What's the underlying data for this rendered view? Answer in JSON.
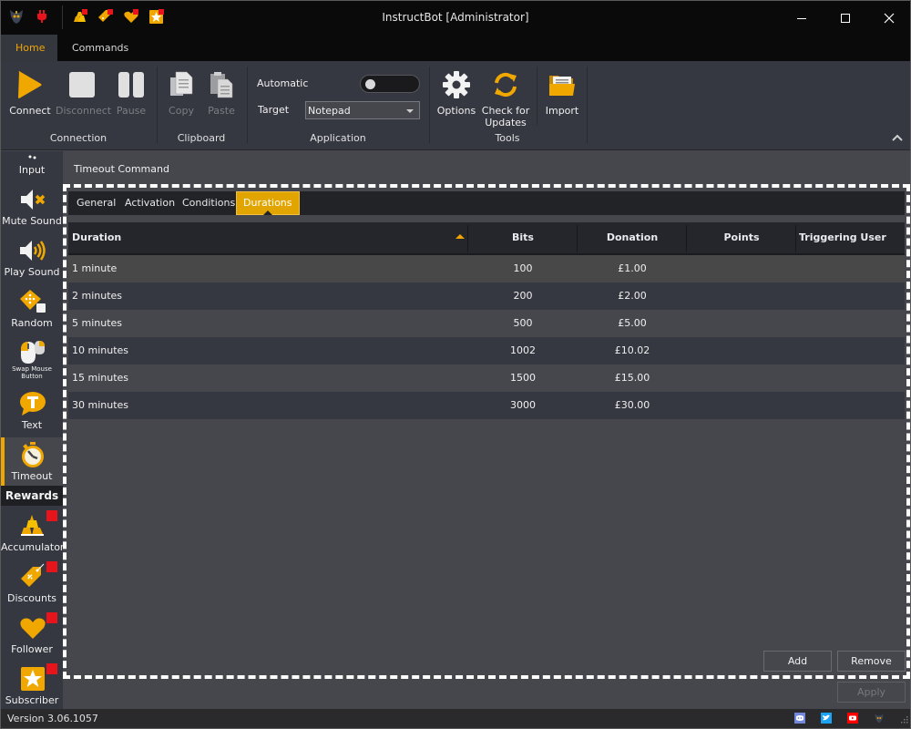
{
  "window": {
    "title": "InstructBot [Administrator]",
    "controls": [
      "minimize",
      "maximize",
      "close"
    ]
  },
  "quick_access": [
    {
      "icon": "instructbot-logo-icon"
    },
    {
      "icon": "plug-icon"
    },
    {
      "icon": "accumulator-icon"
    },
    {
      "icon": "discount-tag-icon"
    },
    {
      "icon": "heart-icon"
    },
    {
      "icon": "star-icon"
    }
  ],
  "menu_tabs": [
    {
      "label": "Home",
      "active": true
    },
    {
      "label": "Commands",
      "active": false
    }
  ],
  "ribbon": {
    "connection": {
      "group_label": "Connection",
      "connect": "Connect",
      "disconnect": "Disconnect",
      "pause": "Pause"
    },
    "clipboard": {
      "group_label": "Clipboard",
      "copy": "Copy",
      "paste": "Paste"
    },
    "application": {
      "group_label": "Application",
      "automatic_label": "Automatic",
      "automatic_on": false,
      "target_label": "Target",
      "target_value": "Notepad"
    },
    "tools": {
      "group_label": "Tools",
      "options": "Options",
      "check_updates": "Check for Updates"
    },
    "import": "Import"
  },
  "sidebar": {
    "items": [
      {
        "label": "Input",
        "icon": "input-icon"
      },
      {
        "label": "Mute Sound",
        "icon": "mute-sound-icon"
      },
      {
        "label": "Play Sound",
        "icon": "play-sound-icon"
      },
      {
        "label": "Random",
        "icon": "dice-icon"
      },
      {
        "label": "Swap Mouse Button",
        "icon": "mouse-icon"
      },
      {
        "label": "Text",
        "icon": "text-bubble-icon"
      },
      {
        "label": "Timeout",
        "icon": "stopwatch-icon",
        "active": true
      }
    ],
    "rewards_header": "Rewards",
    "rewards": [
      {
        "label": "Accumulator",
        "icon": "accumulator-icon",
        "badge": true
      },
      {
        "label": "Discounts",
        "icon": "discount-tag-icon",
        "badge": true
      },
      {
        "label": "Follower",
        "icon": "heart-icon",
        "badge": true
      },
      {
        "label": "Subscriber",
        "icon": "star-icon",
        "badge": true
      }
    ]
  },
  "main": {
    "title": "Timeout Command",
    "tabs": [
      {
        "label": "General"
      },
      {
        "label": "Activation"
      },
      {
        "label": "Conditions"
      },
      {
        "label": "Durations",
        "active": true
      }
    ],
    "grid": {
      "columns": [
        "Duration",
        "Bits",
        "Donation",
        "Points",
        "Triggering User Only"
      ],
      "sort_column": "Duration",
      "sort_direction": "ascending",
      "rows": [
        {
          "duration": "1 minute",
          "bits": "100",
          "donation": "£1.00",
          "points": "",
          "triggering_user_only": "",
          "selected": true
        },
        {
          "duration": "2 minutes",
          "bits": "200",
          "donation": "£2.00",
          "points": "",
          "triggering_user_only": ""
        },
        {
          "duration": "5 minutes",
          "bits": "500",
          "donation": "£5.00",
          "points": "",
          "triggering_user_only": ""
        },
        {
          "duration": "10 minutes",
          "bits": "1002",
          "donation": "£10.02",
          "points": "",
          "triggering_user_only": ""
        },
        {
          "duration": "15 minutes",
          "bits": "1500",
          "donation": "£15.00",
          "points": "",
          "triggering_user_only": ""
        },
        {
          "duration": "30 minutes",
          "bits": "3000",
          "donation": "£30.00",
          "points": "",
          "triggering_user_only": ""
        }
      ]
    },
    "add_label": "Add",
    "remove_label": "Remove",
    "apply_label": "Apply"
  },
  "statusbar": {
    "version": "Version 3.06.1057",
    "social": [
      {
        "icon": "discord-icon",
        "color": "#7289da"
      },
      {
        "icon": "twitter-icon",
        "color": "#1da1f2"
      },
      {
        "icon": "youtube-icon",
        "color": "#ff0000"
      },
      {
        "icon": "instructbot-logo-icon"
      }
    ]
  },
  "colors": {
    "accent": "#f0a500",
    "badge": "#e8141c"
  }
}
